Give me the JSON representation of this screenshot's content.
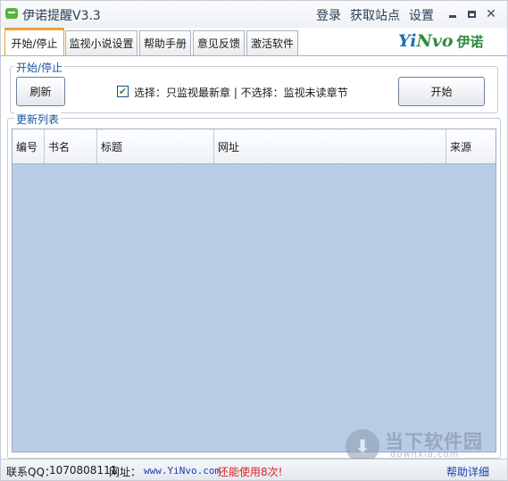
{
  "window": {
    "title": "伊诺提醒V3.3",
    "menu": [
      "登录",
      "获取站点",
      "设置"
    ]
  },
  "tabs": [
    {
      "label": "开始/停止",
      "active": true
    },
    {
      "label": "监视小说设置",
      "active": false
    },
    {
      "label": "帮助手册",
      "active": false
    },
    {
      "label": "意见反馈",
      "active": false
    },
    {
      "label": "激活软件",
      "active": false
    }
  ],
  "logo": {
    "brand_en_y": "Yi",
    "brand_en_rest": "Nvo",
    "brand_cn": "伊诺"
  },
  "control_group": {
    "title": "开始/停止",
    "refresh_label": "刷新",
    "checkbox_checked": true,
    "checkbox_label": "选择：只监视最新章  |  不选择：监视未读章节",
    "start_label": "开始"
  },
  "update_list": {
    "title": "更新列表",
    "columns": [
      "编号",
      "书名",
      "标题",
      "网址",
      "来源"
    ],
    "rows": []
  },
  "watermark": {
    "cn": "当下软件园",
    "en": "downxia.com"
  },
  "status": {
    "contact_label": "联系QQ：",
    "contact_qq": "1070808111",
    "site_label": "网址：",
    "site_url": "www.YiNvo.com",
    "remaining": "还能使用8次!",
    "help_link": "帮助详细"
  },
  "colors": {
    "accent_tab": "#f0a030",
    "table_bg": "#b9cce5",
    "link_blue": "#1a3fb0",
    "warning_red": "#e02020"
  }
}
